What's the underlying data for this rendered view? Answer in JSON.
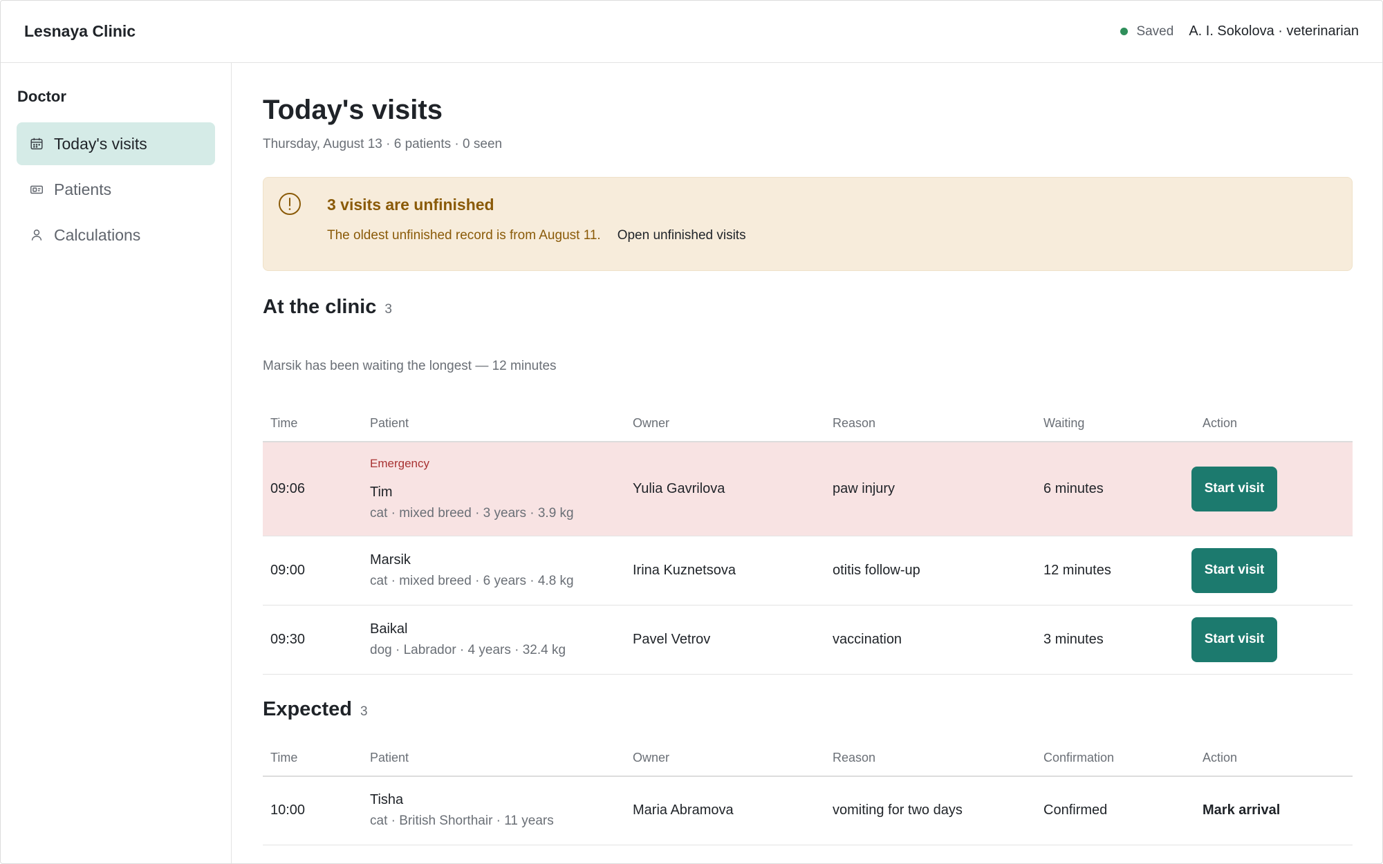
{
  "header": {
    "brand": "Lesnaya Clinic",
    "status": "Saved",
    "user": "A. I. Sokolova · veterinarian",
    "status_color": "#2f8f5b"
  },
  "sidebar": {
    "title": "Doctor",
    "items": [
      {
        "label": "Today's visits",
        "icon": "calendar-icon",
        "active": true
      },
      {
        "label": "Patients",
        "icon": "id-card-icon",
        "active": false
      },
      {
        "label": "Calculations",
        "icon": "user-icon",
        "active": false
      }
    ]
  },
  "main": {
    "title": "Today's visits",
    "subtitle": "Thursday, August 13 · 6 patients · 0 seen",
    "alert": {
      "title": "3 visits are unfinished",
      "text": "The oldest unfinished record is from August 11.",
      "link": "Open unfinished visits",
      "icon": "alert-circle-icon"
    },
    "at_clinic": {
      "title": "At the clinic",
      "count": "3",
      "note": "Marsik has been waiting the longest — 12 minutes",
      "columns": [
        "Time",
        "Patient",
        "Owner",
        "Reason",
        "Waiting",
        "Action"
      ],
      "rows": [
        {
          "emergency": "Emergency",
          "time": "09:06",
          "name": "Tim",
          "desc": "cat · mixed breed · 3 years · 3.9 kg",
          "owner": "Yulia Gavrilova",
          "reason": "paw injury",
          "waiting": "6 minutes",
          "action": "Start visit"
        },
        {
          "time": "09:00",
          "name": "Marsik",
          "desc": "cat · mixed breed · 6 years · 4.8 kg",
          "owner": "Irina Kuznetsova",
          "reason": "otitis follow-up",
          "waiting": "12 minutes",
          "action": "Start visit"
        },
        {
          "time": "09:30",
          "name": "Baikal",
          "desc": "dog · Labrador · 4 years · 32.4 kg",
          "owner": "Pavel Vetrov",
          "reason": "vaccination",
          "waiting": "3 minutes",
          "action": "Start visit"
        }
      ]
    },
    "expected": {
      "title": "Expected",
      "count": "3",
      "columns": [
        "Time",
        "Patient",
        "Owner",
        "Reason",
        "Confirmation",
        "Action"
      ],
      "rows": [
        {
          "time": "10:00",
          "name": "Tisha",
          "desc": "cat · British Shorthair · 11 years",
          "owner": "Maria Abramova",
          "reason": "vomiting for two days",
          "confirmation": "Confirmed",
          "action": "Mark arrival"
        }
      ]
    }
  },
  "colors": {
    "accent": "#1c7a6e",
    "active_nav": "#d5ebe7",
    "alert_bg": "#f7ecdb",
    "alert_text": "#8a5a08",
    "emergency_bg": "#f8e3e3",
    "emergency_text": "#a83232"
  }
}
